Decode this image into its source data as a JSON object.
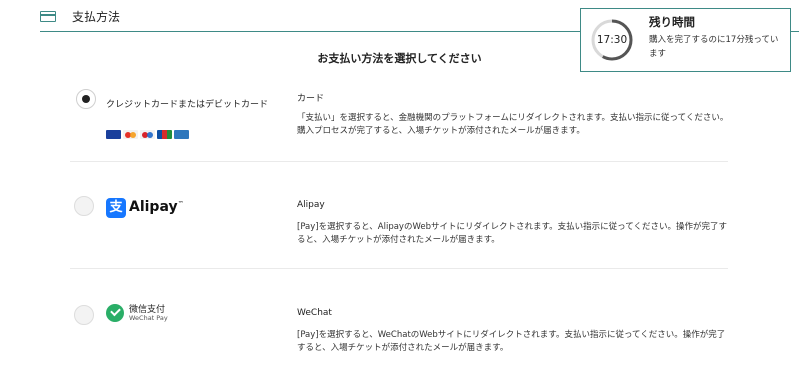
{
  "header": {
    "title": "支払方法",
    "icon": "credit-card-icon"
  },
  "timer": {
    "title": "残り時間",
    "time": "17:30",
    "message": "購入を完了するのに17分残っています",
    "remaining_fraction": 0.58,
    "colors": {
      "ring": "#555555",
      "track": "#d9d9d9",
      "border": "#3e8a86"
    }
  },
  "instruction": "お支払い方法を選択してください",
  "options": [
    {
      "label": "クレジットカードまたはデビットカード",
      "title": "カード",
      "description": "「支払い」を選択すると、金融機関のプラットフォームにリダイレクトされます。支払い指示に従ってください。購入プロセスが完了すると、入場チケットが添付されたメールが届きます。",
      "selected": true,
      "icons": [
        "visa-icon",
        "mastercard-icon",
        "maestro-icon",
        "jcb-icon",
        "amex-icon"
      ]
    },
    {
      "logo_mark": "支",
      "logo_text": "Alipay",
      "logo_trademark": "™",
      "title": "Alipay",
      "description": "[Pay]を選択すると、AlipayのWebサイトにリダイレクトされます。支払い指示に従ってください。操作が完了すると、入場チケットが添付されたメールが届きます。",
      "selected": false
    },
    {
      "logo_cn": "微信支付",
      "logo_en": "WeChat Pay",
      "title": "WeChat",
      "description": "[Pay]を選択すると、WeChatのWebサイトにリダイレクトされます。支払い指示に従ってください。操作が完了すると、入場チケットが添付されたメールが届きます。",
      "selected": false
    }
  ]
}
